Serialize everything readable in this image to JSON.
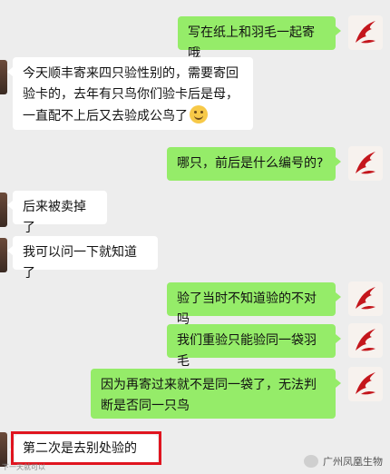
{
  "messages": [
    {
      "side": "right",
      "text": "写在纸上和羽毛一起寄哦"
    },
    {
      "side": "left",
      "text": "今天顺丰寄来四只验性别的，需要寄回验卡的，去年有只鸟你们验卡后是母，一直配不上后又去验成公鸟了"
    },
    {
      "side": "right",
      "text": "哪只，前后是什么编号的?"
    },
    {
      "side": "left",
      "text": "后来被卖掉了"
    },
    {
      "side": "left",
      "text": "我可以问一下就知道了"
    },
    {
      "side": "right",
      "text": "验了当时不知道验的不对吗"
    },
    {
      "side": "right",
      "text": "我们重验只能验同一袋羽毛"
    },
    {
      "side": "right",
      "text": "因为再寄过来就不是同一袋了，无法判断是否同一只鸟"
    },
    {
      "side": "left",
      "text": "第二次是去别处验的"
    }
  ],
  "watermark": {
    "text": "广州凤凰生物"
  },
  "corner_text": "下一天就可以",
  "icons": {
    "emoji": "smile-emoji-icon",
    "avatar": "red-phoenix-logo"
  },
  "colors": {
    "bubble_right": "#95ec69",
    "bubble_left": "#ffffff",
    "background": "#ededed",
    "highlight": "#e0141f",
    "logo": "#c4161c"
  }
}
